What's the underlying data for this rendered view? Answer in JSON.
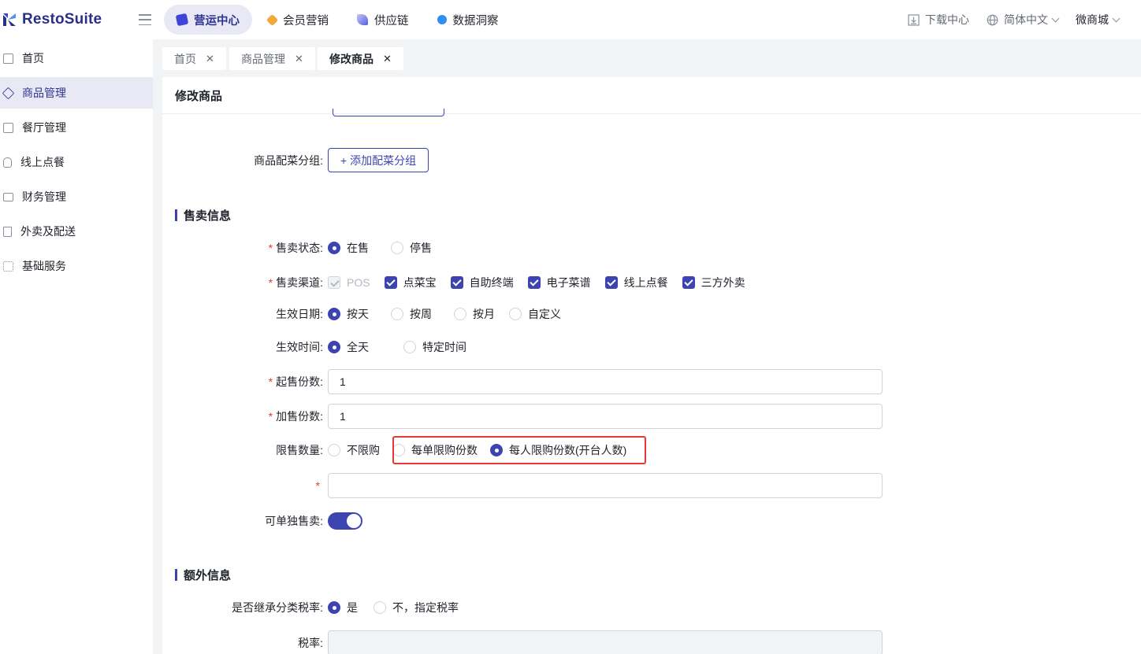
{
  "app": {
    "logo_text": "RestoSuite"
  },
  "top_nav": {
    "tabs": [
      {
        "label": "营运中心",
        "color": "#3d44d6",
        "active": true
      },
      {
        "label": "会员营销",
        "color": "#f2a93b",
        "active": false
      },
      {
        "label": "供应链",
        "color": "#5b5fe0",
        "active": false
      },
      {
        "label": "数据洞察",
        "color": "#2f8ef5",
        "active": false
      }
    ],
    "download_center": "下载中心",
    "language": "简体中文",
    "user": "微商城"
  },
  "sidebar": {
    "items": [
      {
        "label": "首页",
        "icon": "home-icon"
      },
      {
        "label": "商品管理",
        "icon": "cube-icon",
        "active": true
      },
      {
        "label": "餐厅管理",
        "icon": "store-icon"
      },
      {
        "label": "线上点餐",
        "icon": "hand-pointer-icon"
      },
      {
        "label": "财务管理",
        "icon": "folder-icon"
      },
      {
        "label": "外卖及配送",
        "icon": "bag-icon"
      },
      {
        "label": "基础服务",
        "icon": "grid-icon"
      }
    ]
  },
  "page_tabs": [
    {
      "label": "首页"
    },
    {
      "label": "商品管理"
    },
    {
      "label": "修改商品",
      "active": true
    }
  ],
  "panel": {
    "title": "修改商品",
    "side_dish_group_label": "商品配菜分组:",
    "add_side_dish_group_button": "+ 添加配菜分组",
    "sales_section_title": "售卖信息",
    "sale_status": {
      "label": "售卖状态:",
      "options": [
        "在售",
        "停售"
      ],
      "selected": "在售"
    },
    "sale_channel": {
      "label": "售卖渠道:",
      "options": [
        "POS",
        "点菜宝",
        "自助终端",
        "电子菜谱",
        "线上点餐",
        "三方外卖"
      ]
    },
    "effective_date": {
      "label": "生效日期:",
      "options": [
        "按天",
        "按周",
        "按月",
        "自定义"
      ],
      "selected": "按天"
    },
    "effective_time": {
      "label": "生效时间:",
      "options": [
        "全天",
        "特定时间"
      ],
      "selected": "全天"
    },
    "min_sale_qty": {
      "label": "起售份数:",
      "value": "1"
    },
    "increment_qty": {
      "label": "加售份数:",
      "value": "1"
    },
    "limit_qty": {
      "label": "限售数量:",
      "options": [
        "不限购",
        "每单限购份数",
        "每人限购份数(开台人数)"
      ],
      "selected": "每人限购份数(开台人数)"
    },
    "limit_value": {
      "value": ""
    },
    "sell_alone": {
      "label": "可单独售卖:",
      "on": true
    },
    "extra_section_title": "额外信息",
    "inherit_tax": {
      "label": "是否继承分类税率:",
      "options": [
        "是",
        "不，指定税率"
      ],
      "selected": "是"
    },
    "tax_rate": {
      "label": "税率:",
      "value": ""
    }
  }
}
